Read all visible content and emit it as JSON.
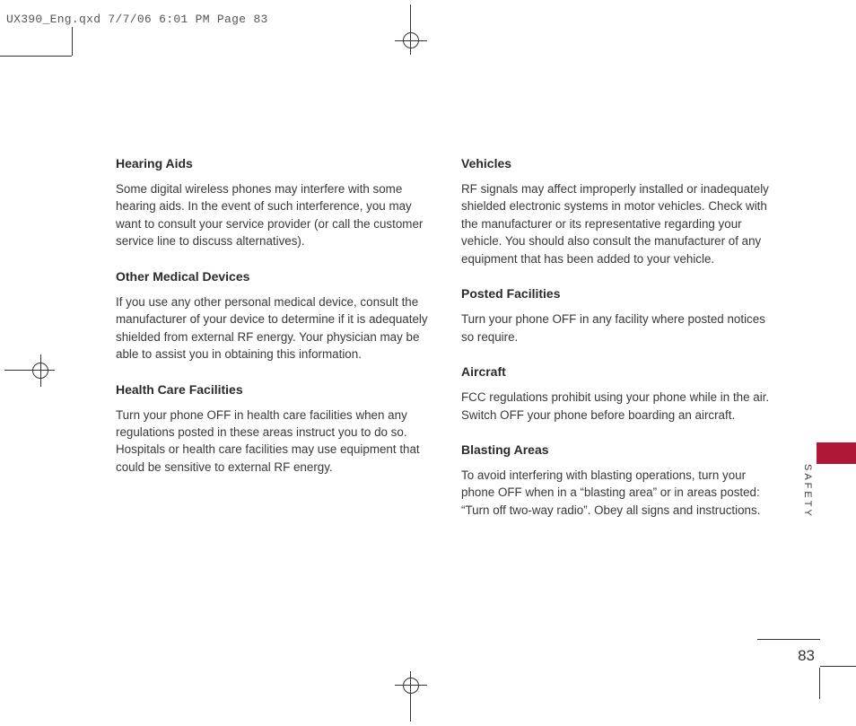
{
  "header": "UX390_Eng.qxd  7/7/06  6:01 PM  Page 83",
  "sideLabel": "SAFETY",
  "pageNumber": "83",
  "left": [
    {
      "heading": "Hearing Aids",
      "body": "Some digital wireless phones may interfere with some hearing aids. In the event of such interference, you may want to consult your service provider (or call the customer service line to discuss alternatives)."
    },
    {
      "heading": "Other Medical Devices",
      "body": "If you use any other personal medical device, consult the manufacturer of your device to determine if it is adequately shielded from external RF energy. Your physician may be able to assist you in obtaining this information."
    },
    {
      "heading": "Health Care Facilities",
      "body": "Turn your phone OFF in health care facilities when any regulations posted in these areas instruct you to do so. Hospitals or health care facilities may use equipment that could be sensitive to external RF energy."
    }
  ],
  "right": [
    {
      "heading": "Vehicles",
      "body": "RF signals may affect improperly installed or inadequately shielded electronic systems in motor vehicles. Check with the manufacturer or its representative regarding your vehicle.  You should also consult the manufacturer of any equipment that has been added to your vehicle."
    },
    {
      "heading": "Posted Facilities",
      "body": "Turn your phone OFF in any facility where posted notices so require."
    },
    {
      "heading": "Aircraft",
      "body": "FCC regulations prohibit using your phone while in the air. Switch OFF your phone before boarding an aircraft."
    },
    {
      "heading": "Blasting Areas",
      "body": "To avoid interfering with blasting operations, turn your phone OFF when in a “blasting area” or in areas posted: “Turn off two-way radio”. Obey all signs and instructions."
    }
  ]
}
